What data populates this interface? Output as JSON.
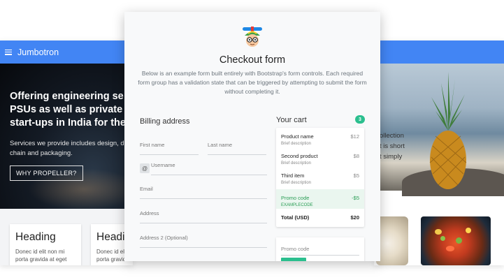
{
  "left_page": {
    "appbar_title": "Jumbotron",
    "hero_title": "Offering engineering se PSUs as well as private start-ups in India for the",
    "hero_text": "Services we provide includes design, de supply chain and packaging.",
    "hero_button": "WHY PROPELLER?",
    "cards": [
      {
        "heading": "Heading",
        "text": "Donec id elit non mi porta gravida at eget"
      },
      {
        "heading": "Headi",
        "text": "Donec id elit non mi porta gravida at eget"
      }
    ]
  },
  "right_page": {
    "text_lines": [
      "ollection",
      "t is short",
      "t simply"
    ]
  },
  "checkout": {
    "title": "Checkout form",
    "description": "Below is an example form built entirely with Bootstrap's form controls. Each required form group has a validation state that can be triggered by attempting to submit the form without completing it.",
    "billing": {
      "title": "Billing address",
      "first_name_label": "First name",
      "last_name_label": "Last name",
      "at_symbol": "@",
      "username_label": "Username",
      "email_label": "Email",
      "address_label": "Address",
      "address2_label": "Address 2 (Optional)"
    },
    "cart": {
      "title": "Your cart",
      "count": "3",
      "items": [
        {
          "name": "Product name",
          "desc": "Brief description",
          "price": "$12"
        },
        {
          "name": "Second product",
          "desc": "Brief description",
          "price": "$8"
        },
        {
          "name": "Third item",
          "desc": "Brief description",
          "price": "$5"
        }
      ],
      "promo": {
        "name": "Promo code",
        "code": "EXAMPLECODE",
        "price": "-$5"
      },
      "total": {
        "label": "Total (USD)",
        "price": "$20"
      },
      "promo_placeholder": "Promo code"
    }
  },
  "colors": {
    "appbar": "#4285f4",
    "badge": "#2bbf8e",
    "promo_text": "#2a9d55"
  }
}
